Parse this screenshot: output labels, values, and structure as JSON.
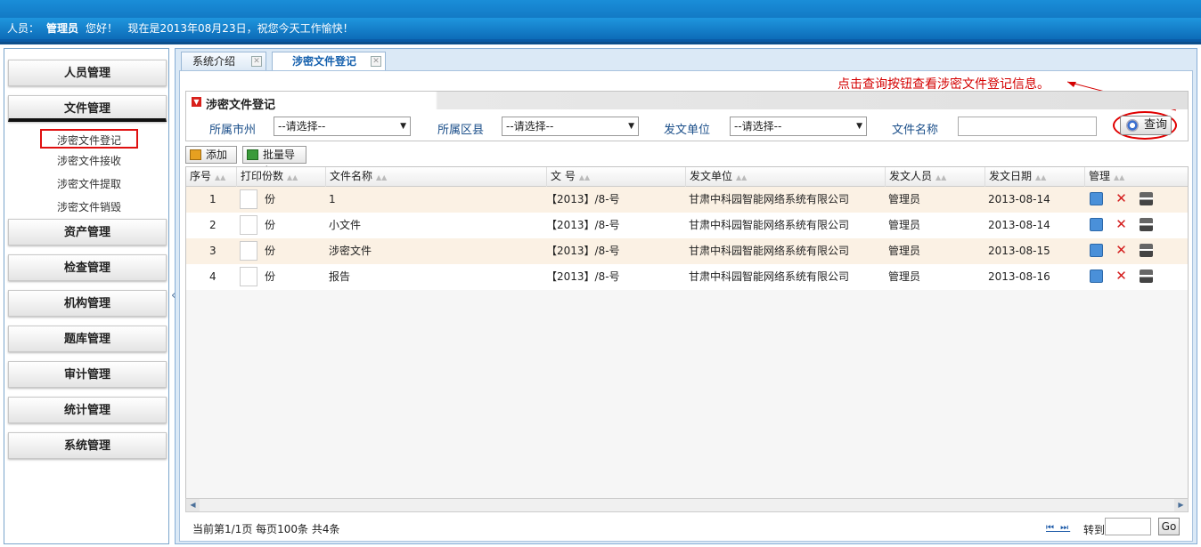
{
  "header": {
    "person_label": "人员：",
    "user_name": "管理员",
    "greeting": "您好！",
    "date_text": "现在是2013年08月23日，祝您今天工作愉快！"
  },
  "sidebar": {
    "collapse_glyph": "«",
    "menu": [
      {
        "label": "人员管理"
      },
      {
        "label": "文件管理"
      },
      {
        "label": "资产管理"
      },
      {
        "label": "检查管理"
      },
      {
        "label": "机构管理"
      },
      {
        "label": "题库管理"
      },
      {
        "label": "审计管理"
      },
      {
        "label": "统计管理"
      },
      {
        "label": "系统管理"
      }
    ],
    "file_submenu": [
      {
        "label": "涉密文件登记"
      },
      {
        "label": "涉密文件接收"
      },
      {
        "label": "涉密文件提取"
      },
      {
        "label": "涉密文件销毁"
      }
    ]
  },
  "tabs": [
    {
      "label": "系统介绍"
    },
    {
      "label": "涉密文件登记"
    }
  ],
  "annotation": "点击查询按钮查看涉密文件登记信息。",
  "search": {
    "title": "涉密文件登记",
    "city_label": "所属市州",
    "city_value": "--请选择--",
    "district_label": "所属区县",
    "district_value": "--请选择--",
    "issuer_label": "发文单位",
    "issuer_value": "--请选择--",
    "filename_label": "文件名称",
    "filename_value": "",
    "query_label": "查询"
  },
  "toolbar": {
    "add_label": "添加",
    "import_label": "批量导入"
  },
  "grid": {
    "columns": [
      "序号",
      "打印份数",
      "文件名称",
      "文 号",
      "发文单位",
      "发文人员",
      "发文日期",
      "管理"
    ],
    "copies_unit": "份",
    "rows": [
      {
        "no": "1",
        "name": "1",
        "doc_no": "【2013】/8-号",
        "unit": "甘肃中科园智能网络系统有限公司",
        "person": "管理员",
        "date": "2013-08-14"
      },
      {
        "no": "2",
        "name": "小文件",
        "doc_no": "【2013】/8-号",
        "unit": "甘肃中科园智能网络系统有限公司",
        "person": "管理员",
        "date": "2013-08-14"
      },
      {
        "no": "3",
        "name": "涉密文件",
        "doc_no": "【2013】/8-号",
        "unit": "甘肃中科园智能网络系统有限公司",
        "person": "管理员",
        "date": "2013-08-15"
      },
      {
        "no": "4",
        "name": "报告",
        "doc_no": "【2013】/8-号",
        "unit": "甘肃中科园智能网络系统有限公司",
        "person": "管理员",
        "date": "2013-08-16"
      }
    ]
  },
  "pager": {
    "info": "当前第1/1页  每页100条  共4条",
    "nav_glyphs": "⏮ ⏭",
    "goto_label": "转到",
    "goto_value": "",
    "go_label": "Go"
  },
  "icons": {
    "view": "magnifier-icon",
    "delete": "delete-x-icon",
    "print": "printer-icon"
  }
}
